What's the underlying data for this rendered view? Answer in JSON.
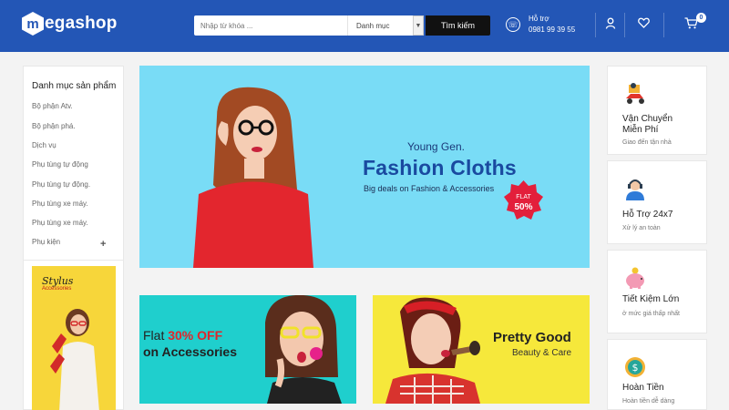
{
  "header": {
    "logo_mark": "m",
    "logo_text": "egashop",
    "search_placeholder": "Nhập từ khóa ...",
    "category_select": "Danh mục",
    "search_button": "Tìm kiếm",
    "support_label": "Hỗ trợ",
    "support_phone": "0981 99 39 55",
    "cart_count": "0",
    "icons": [
      "phone-icon",
      "user-icon",
      "heart-icon",
      "cart-icon"
    ]
  },
  "sidebar": {
    "title": "Danh mục sản phẩm",
    "items": [
      "Bộ phận Atv.",
      "Bộ phận phá.",
      "Dịch vụ",
      "Phụ tùng tự động",
      "Phụ tùng tự động.",
      "Phụ tùng xe máy.",
      "Phụ tùng xe máy.",
      "Phụ kiện"
    ],
    "expand_symbol": "+",
    "banner": {
      "title": "Stylus",
      "subtitle": "Accessories"
    }
  },
  "hero": {
    "badge_top": "FLAT",
    "badge_pct": "50%",
    "subtitle": "Young Gen.",
    "title": "Fashion Cloths",
    "description": "Big deals on Fashion & Accessories"
  },
  "promo_left": {
    "line1_prefix": "Flat ",
    "line1_highlight": "30% OFF",
    "line2": "on Accessories"
  },
  "promo_right": {
    "title": "Pretty Good",
    "description": "Beauty & Care"
  },
  "services": [
    {
      "icon": "delivery-scooter-icon",
      "title_line1": "Vận Chuyển",
      "title_line2": "Miễn Phí",
      "desc": "Giao đến tận nhà"
    },
    {
      "icon": "support-agent-icon",
      "title_line1": "Hỗ Trợ 24x7",
      "title_line2": "",
      "desc": "Xử lý an toàn"
    },
    {
      "icon": "piggy-bank-icon",
      "title_line1": "Tiết Kiệm Lớn",
      "title_line2": "",
      "desc": "ở mức giá thấp nhất"
    },
    {
      "icon": "money-back-icon",
      "title_line1": "Hoàn Tiền",
      "title_line2": "",
      "desc": "Hoàn tiền dễ dàng"
    }
  ],
  "colors": {
    "header_bg": "#2356b6",
    "hero_bg": "#79dcf6",
    "promo_left_bg": "#1fcfcd",
    "promo_right_bg": "#f6e83b",
    "accent_red": "#e1262b"
  }
}
